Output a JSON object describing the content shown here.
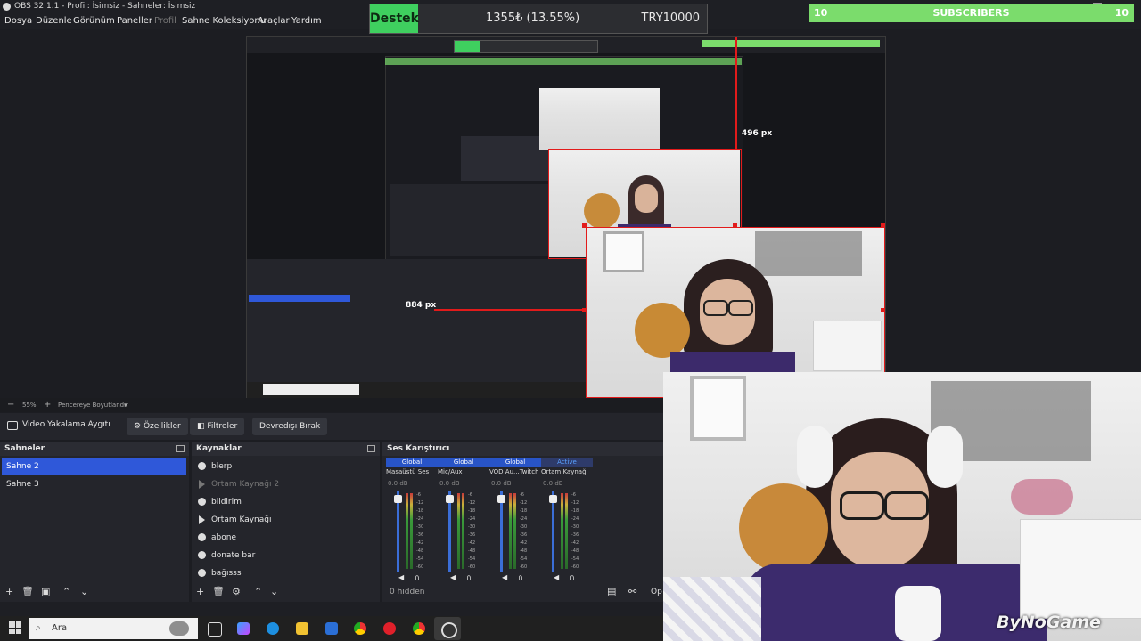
{
  "window": {
    "title": "OBS 32.1.1 - Profil: İsimsiz - Sahneler: İsimsiz"
  },
  "menu": [
    "Dosya",
    "Düzenle",
    "Görünüm",
    "Paneller",
    "Profil",
    "Sahne Koleksiyonu",
    "Araçlar",
    "Yardım"
  ],
  "overlay": {
    "support_label": "Destek",
    "support_amount": "1355₺ (13.55%)",
    "support_goal": "TRY10000",
    "subs_left": "10",
    "subs_label": "SUBSCRIBERS",
    "subs_right": "10"
  },
  "preview": {
    "size_label_1": "496 px",
    "size_label_2": "884 px"
  },
  "zoom": {
    "value": "55%",
    "fit_label": "Pencereye Boyutlandır"
  },
  "source_toolbar": {
    "device": "Video Yakalama Aygıtı",
    "properties": "Özellikler",
    "filters": "Filtreler",
    "deactivate": "Devredışı Bırak"
  },
  "scenes": {
    "title": "Sahneler",
    "items": [
      "Sahne 2",
      "Sahne 3"
    ],
    "selected": 0
  },
  "sources": {
    "title": "Kaynaklar",
    "items": [
      {
        "name": "blerp",
        "type": "browser",
        "visible": true
      },
      {
        "name": "Ortam Kaynağı 2",
        "type": "media",
        "visible": false
      },
      {
        "name": "bildirim",
        "type": "browser",
        "visible": true
      },
      {
        "name": "Ortam Kaynağı",
        "type": "media",
        "visible": true
      },
      {
        "name": "abone",
        "type": "browser",
        "visible": true
      },
      {
        "name": "donate bar",
        "type": "browser",
        "visible": true
      },
      {
        "name": "bağısss",
        "type": "browser",
        "visible": true
      }
    ]
  },
  "mixer": {
    "title": "Ses Karıştırıcı",
    "channels": [
      {
        "tag": "Global",
        "name": "Masaüstü Ses",
        "db": "0.0 dB"
      },
      {
        "tag": "Global",
        "name": "Mic/Aux",
        "db": "0.0 dB"
      },
      {
        "tag": "Global",
        "name": "VOD Au...Twitch",
        "db": "0.0 dB"
      },
      {
        "tag": "Active",
        "name": "Ortam Kaynağı",
        "db": "0.0 dB"
      }
    ],
    "ticks": [
      "-6",
      "-12",
      "-18",
      "-24",
      "-30",
      "-36",
      "-42",
      "-48",
      "-54",
      "-60"
    ],
    "hidden_label": "0 hidden",
    "more_label": "Op"
  },
  "taskbar": {
    "search_placeholder": "Ara"
  },
  "watermark": "ByNoGame",
  "colors": {
    "accent": "#2f58d9",
    "support_green": "#3fcf5f",
    "subs_green": "#7bdc6c",
    "selection_red": "#e21b1b"
  }
}
